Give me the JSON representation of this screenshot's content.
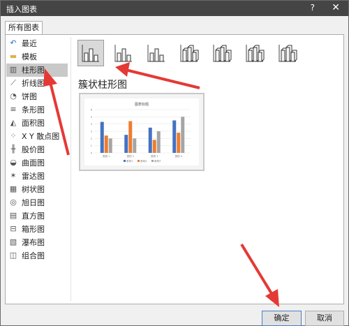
{
  "window": {
    "title": "插入图表",
    "help": "?",
    "close": "✕"
  },
  "tab": {
    "label": "所有图表"
  },
  "sidebar": {
    "items": [
      {
        "label": "最近",
        "icon": "undo-icon"
      },
      {
        "label": "模板",
        "icon": "folder-icon"
      },
      {
        "label": "柱形图",
        "icon": "column-chart-icon"
      },
      {
        "label": "折线图",
        "icon": "line-chart-icon"
      },
      {
        "label": "饼图",
        "icon": "pie-chart-icon"
      },
      {
        "label": "条形图",
        "icon": "bar-chart-icon"
      },
      {
        "label": "面积图",
        "icon": "area-chart-icon"
      },
      {
        "label": "X Y 散点图",
        "icon": "scatter-chart-icon"
      },
      {
        "label": "股价图",
        "icon": "stock-chart-icon"
      },
      {
        "label": "曲面图",
        "icon": "surface-chart-icon"
      },
      {
        "label": "雷达图",
        "icon": "radar-chart-icon"
      },
      {
        "label": "树状图",
        "icon": "treemap-chart-icon"
      },
      {
        "label": "旭日图",
        "icon": "sunburst-chart-icon"
      },
      {
        "label": "直方图",
        "icon": "histogram-chart-icon"
      },
      {
        "label": "箱形图",
        "icon": "boxplot-chart-icon"
      },
      {
        "label": "瀑布图",
        "icon": "waterfall-chart-icon"
      },
      {
        "label": "组合图",
        "icon": "combo-chart-icon"
      }
    ],
    "selected_index": 2
  },
  "chart_subtype": {
    "title": "簇状柱形图",
    "selected_index": 0,
    "count": 7
  },
  "preview": {
    "title": "图表标题",
    "categories": [
      "类别 1",
      "类别 2",
      "类别 3",
      "类别 4"
    ],
    "legend": [
      "系列1",
      "系列2",
      "系列3"
    ],
    "colors": [
      "#4472c4",
      "#ed7d31",
      "#a5a5a5"
    ]
  },
  "chart_data": {
    "type": "bar",
    "title": "图表标题",
    "categories": [
      "类别 1",
      "类别 2",
      "类别 3",
      "类别 4"
    ],
    "series": [
      {
        "name": "系列1",
        "values": [
          4.3,
          2.5,
          3.5,
          4.5
        ]
      },
      {
        "name": "系列2",
        "values": [
          2.4,
          4.4,
          1.8,
          2.8
        ]
      },
      {
        "name": "系列3",
        "values": [
          2,
          2,
          3,
          5
        ]
      }
    ],
    "ylim": [
      0,
      6
    ],
    "grid": true,
    "legend": "bottom"
  },
  "footer": {
    "ok_label": "确定",
    "cancel_label": "取消"
  }
}
